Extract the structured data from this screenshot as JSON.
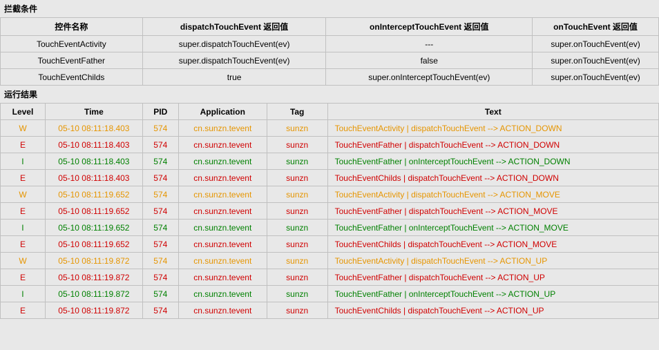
{
  "sections": {
    "conditions_title": "拦截条件",
    "results_title": "运行结果"
  },
  "conditions": {
    "headers": {
      "name": "控件名称",
      "dispatch": "dispatchTouchEvent 返回值",
      "intercept": "onInterceptTouchEvent 返回值",
      "touch": "onTouchEvent 返回值"
    },
    "rows": [
      {
        "name": "TouchEventActivity",
        "dispatch": "super.dispatchTouchEvent(ev)",
        "intercept": "---",
        "touch": "super.onTouchEvent(ev)"
      },
      {
        "name": "TouchEventFather",
        "dispatch": "super.dispatchTouchEvent(ev)",
        "intercept": "false",
        "touch": "super.onTouchEvent(ev)"
      },
      {
        "name": "TouchEventChilds",
        "dispatch": "true",
        "intercept": "super.onInterceptTouchEvent(ev)",
        "touch": "super.onTouchEvent(ev)"
      }
    ]
  },
  "log": {
    "headers": {
      "level": "Level",
      "time": "Time",
      "pid": "PID",
      "app": "Application",
      "tag": "Tag",
      "text": "Text"
    },
    "rows": [
      {
        "level": "W",
        "time": "05-10 08:11:18.403",
        "pid": "574",
        "app": "cn.sunzn.tevent",
        "tag": "sunzn",
        "text": "TouchEventActivity | dispatchTouchEvent --> ACTION_DOWN"
      },
      {
        "level": "E",
        "time": "05-10 08:11:18.403",
        "pid": "574",
        "app": "cn.sunzn.tevent",
        "tag": "sunzn",
        "text": "TouchEventFather | dispatchTouchEvent --> ACTION_DOWN"
      },
      {
        "level": "I",
        "time": "05-10 08:11:18.403",
        "pid": "574",
        "app": "cn.sunzn.tevent",
        "tag": "sunzn",
        "text": "TouchEventFather | onInterceptTouchEvent --> ACTION_DOWN"
      },
      {
        "level": "E",
        "time": "05-10 08:11:18.403",
        "pid": "574",
        "app": "cn.sunzn.tevent",
        "tag": "sunzn",
        "text": "TouchEventChilds | dispatchTouchEvent --> ACTION_DOWN"
      },
      {
        "level": "W",
        "time": "05-10 08:11:19.652",
        "pid": "574",
        "app": "cn.sunzn.tevent",
        "tag": "sunzn",
        "text": "TouchEventActivity | dispatchTouchEvent --> ACTION_MOVE"
      },
      {
        "level": "E",
        "time": "05-10 08:11:19.652",
        "pid": "574",
        "app": "cn.sunzn.tevent",
        "tag": "sunzn",
        "text": "TouchEventFather | dispatchTouchEvent --> ACTION_MOVE"
      },
      {
        "level": "I",
        "time": "05-10 08:11:19.652",
        "pid": "574",
        "app": "cn.sunzn.tevent",
        "tag": "sunzn",
        "text": "TouchEventFather | onInterceptTouchEvent --> ACTION_MOVE"
      },
      {
        "level": "E",
        "time": "05-10 08:11:19.652",
        "pid": "574",
        "app": "cn.sunzn.tevent",
        "tag": "sunzn",
        "text": "TouchEventChilds | dispatchTouchEvent --> ACTION_MOVE"
      },
      {
        "level": "W",
        "time": "05-10 08:11:19.872",
        "pid": "574",
        "app": "cn.sunzn.tevent",
        "tag": "sunzn",
        "text": "TouchEventActivity | dispatchTouchEvent --> ACTION_UP"
      },
      {
        "level": "E",
        "time": "05-10 08:11:19.872",
        "pid": "574",
        "app": "cn.sunzn.tevent",
        "tag": "sunzn",
        "text": "TouchEventFather | dispatchTouchEvent --> ACTION_UP"
      },
      {
        "level": "I",
        "time": "05-10 08:11:19.872",
        "pid": "574",
        "app": "cn.sunzn.tevent",
        "tag": "sunzn",
        "text": "TouchEventFather | onInterceptTouchEvent --> ACTION_UP"
      },
      {
        "level": "E",
        "time": "05-10 08:11:19.872",
        "pid": "574",
        "app": "cn.sunzn.tevent",
        "tag": "sunzn",
        "text": "TouchEventChilds | dispatchTouchEvent --> ACTION_UP"
      }
    ]
  }
}
